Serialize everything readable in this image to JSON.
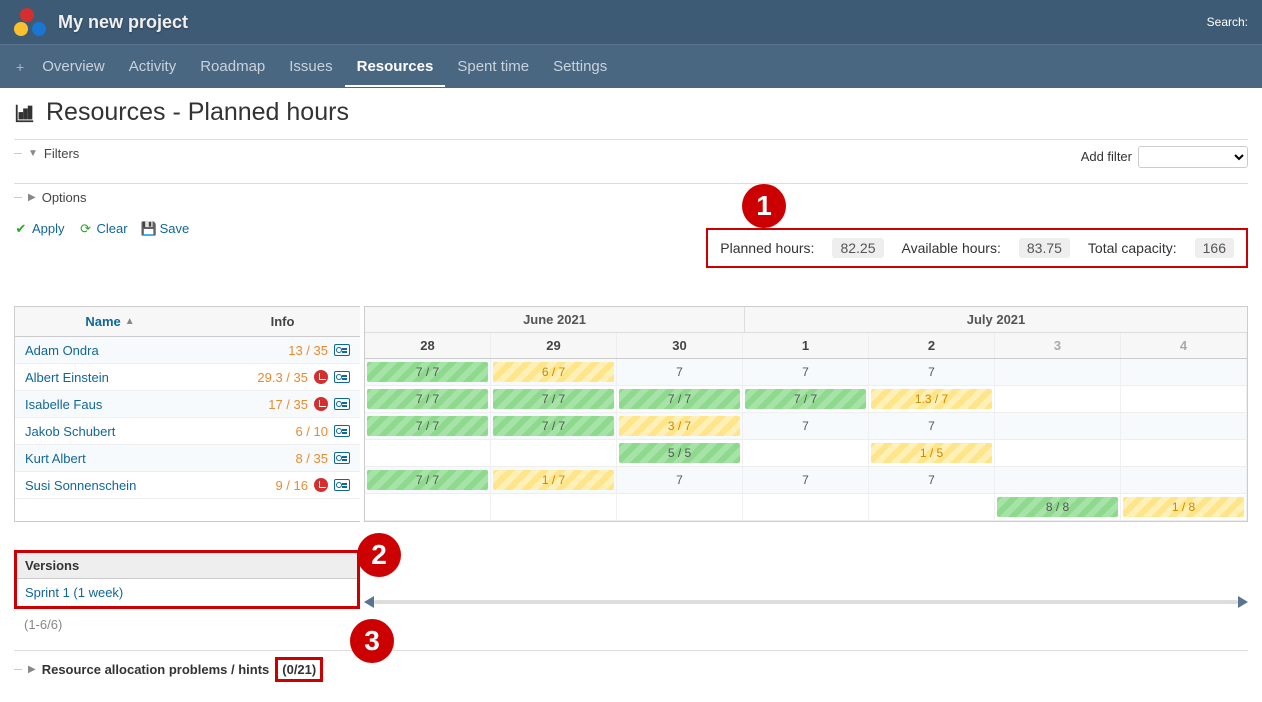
{
  "header": {
    "project_title": "My new project",
    "search_label": "Search:"
  },
  "nav": {
    "items": [
      {
        "label": "Overview"
      },
      {
        "label": "Activity"
      },
      {
        "label": "Roadmap"
      },
      {
        "label": "Issues"
      },
      {
        "label": "Resources",
        "active": true
      },
      {
        "label": "Spent time"
      },
      {
        "label": "Settings"
      }
    ]
  },
  "page_title": "Resources - Planned hours",
  "filters": {
    "label": "Filters",
    "add_filter_label": "Add filter"
  },
  "options": {
    "label": "Options"
  },
  "actions": {
    "apply": "Apply",
    "clear": "Clear",
    "save": "Save"
  },
  "summary": {
    "planned_label": "Planned hours:",
    "planned_value": "82.25",
    "available_label": "Available hours:",
    "available_value": "83.75",
    "capacity_label": "Total capacity:",
    "capacity_value": "166"
  },
  "annotations": {
    "one": "1",
    "two": "2",
    "three": "3"
  },
  "table": {
    "name_header": "Name",
    "info_header": "Info",
    "months": [
      "June 2021",
      "July 2021"
    ],
    "days": [
      "28",
      "29",
      "30",
      "1",
      "2",
      "3",
      "4"
    ],
    "weekend_idx": [
      5,
      6
    ],
    "rows": [
      {
        "name": "Adam Ondra",
        "ratio": "13 / 35",
        "clock": false,
        "cells": [
          {
            "t": "7 / 7",
            "c": "green"
          },
          {
            "t": "6 / 7",
            "c": "yellow"
          },
          {
            "t": "7"
          },
          {
            "t": "7"
          },
          {
            "t": "7"
          },
          {
            "t": ""
          },
          {
            "t": ""
          }
        ]
      },
      {
        "name": "Albert Einstein",
        "ratio": "29.3 / 35",
        "clock": true,
        "cells": [
          {
            "t": "7 / 7",
            "c": "green"
          },
          {
            "t": "7 / 7",
            "c": "green"
          },
          {
            "t": "7 / 7",
            "c": "green"
          },
          {
            "t": "7 / 7",
            "c": "green"
          },
          {
            "t": "1.3 / 7",
            "c": "yellow"
          },
          {
            "t": ""
          },
          {
            "t": ""
          }
        ]
      },
      {
        "name": "Isabelle Faus",
        "ratio": "17 / 35",
        "clock": true,
        "cells": [
          {
            "t": "7 / 7",
            "c": "green"
          },
          {
            "t": "7 / 7",
            "c": "green"
          },
          {
            "t": "3 / 7",
            "c": "yellow"
          },
          {
            "t": "7"
          },
          {
            "t": "7"
          },
          {
            "t": ""
          },
          {
            "t": ""
          }
        ]
      },
      {
        "name": "Jakob Schubert",
        "ratio": "6 / 10",
        "clock": false,
        "cells": [
          {
            "t": ""
          },
          {
            "t": ""
          },
          {
            "t": "5 / 5",
            "c": "green"
          },
          {
            "t": ""
          },
          {
            "t": "1 / 5",
            "c": "yellow"
          },
          {
            "t": ""
          },
          {
            "t": ""
          }
        ]
      },
      {
        "name": "Kurt Albert",
        "ratio": "8 / 35",
        "clock": false,
        "cells": [
          {
            "t": "7 / 7",
            "c": "green"
          },
          {
            "t": "1 / 7",
            "c": "yellow"
          },
          {
            "t": "7"
          },
          {
            "t": "7"
          },
          {
            "t": "7"
          },
          {
            "t": ""
          },
          {
            "t": ""
          }
        ]
      },
      {
        "name": "Susi Sonnenschein",
        "ratio": "9 / 16",
        "clock": true,
        "cells": [
          {
            "t": ""
          },
          {
            "t": ""
          },
          {
            "t": ""
          },
          {
            "t": ""
          },
          {
            "t": ""
          },
          {
            "t": "8 / 8",
            "c": "green"
          },
          {
            "t": "1 / 8",
            "c": "yellow"
          }
        ]
      }
    ]
  },
  "versions": {
    "header": "Versions",
    "items": [
      "Sprint 1 (1 week)"
    ]
  },
  "pager": "(1-6/6)",
  "hints": {
    "label": "Resource allocation problems / hints",
    "count": "(0/21)"
  }
}
